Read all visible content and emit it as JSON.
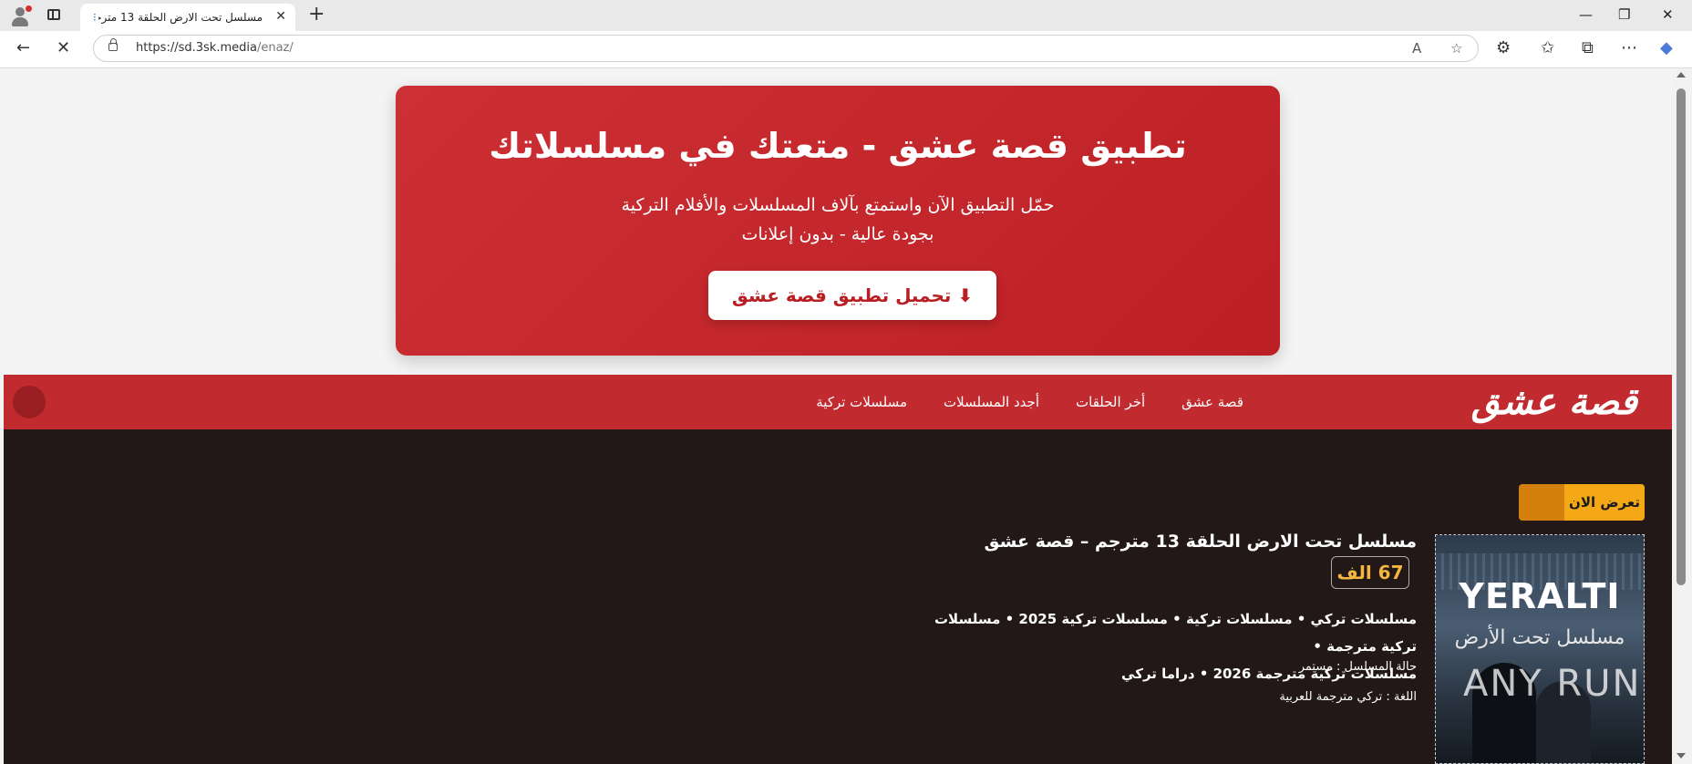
{
  "browser": {
    "tab_title": "مسلسل تحت الارض الحلقة 13 مترجم",
    "url_host": "https://sd.3sk.media",
    "url_path": "/enaz/"
  },
  "banner": {
    "title": "تطبيق قصة عشق - متعتك في مسلسلاتك",
    "subtitle_line1": "حمّل التطبيق الآن واستمتع بآلاف المسلسلات والأفلام التركية",
    "subtitle_line2": "بجودة عالية - بدون إعلانات",
    "button_label": "⬇ تحميل تطبيق قصة عشق"
  },
  "nav": {
    "logo": "قصة عشق",
    "items": [
      "قصة عشق",
      "أخر الحلقات",
      "أجدد المسلسلات",
      "مسلسلات تركية"
    ]
  },
  "content": {
    "now_showing": "تعرض الان",
    "episode_title": "مسلسل تحت الارض الحلقة 13 مترجم – قصة عشق",
    "views": "67 الف",
    "categories_line1": "مسلسلات تركي • مسلسلات تركية • مسلسلات تركية 2025 • مسلسلات تركية مترجمة •",
    "categories_line2": "مسلسلات تركية مترجمة 2026 • دراما تركي",
    "status": "حالة المسلسل : مستمر",
    "language": "اللغة : تركي مترجمة للعربية",
    "poster": {
      "title": "YERALTI",
      "subtitle": "مسلسل تحت الأرض",
      "watermark": "ANY RUN"
    }
  },
  "colors": {
    "banner_red": "#c62a2e",
    "nav_red": "#c12a2e",
    "content_bg": "#231818",
    "accent_orange": "#f5a815",
    "views_gold": "#f5b640"
  }
}
